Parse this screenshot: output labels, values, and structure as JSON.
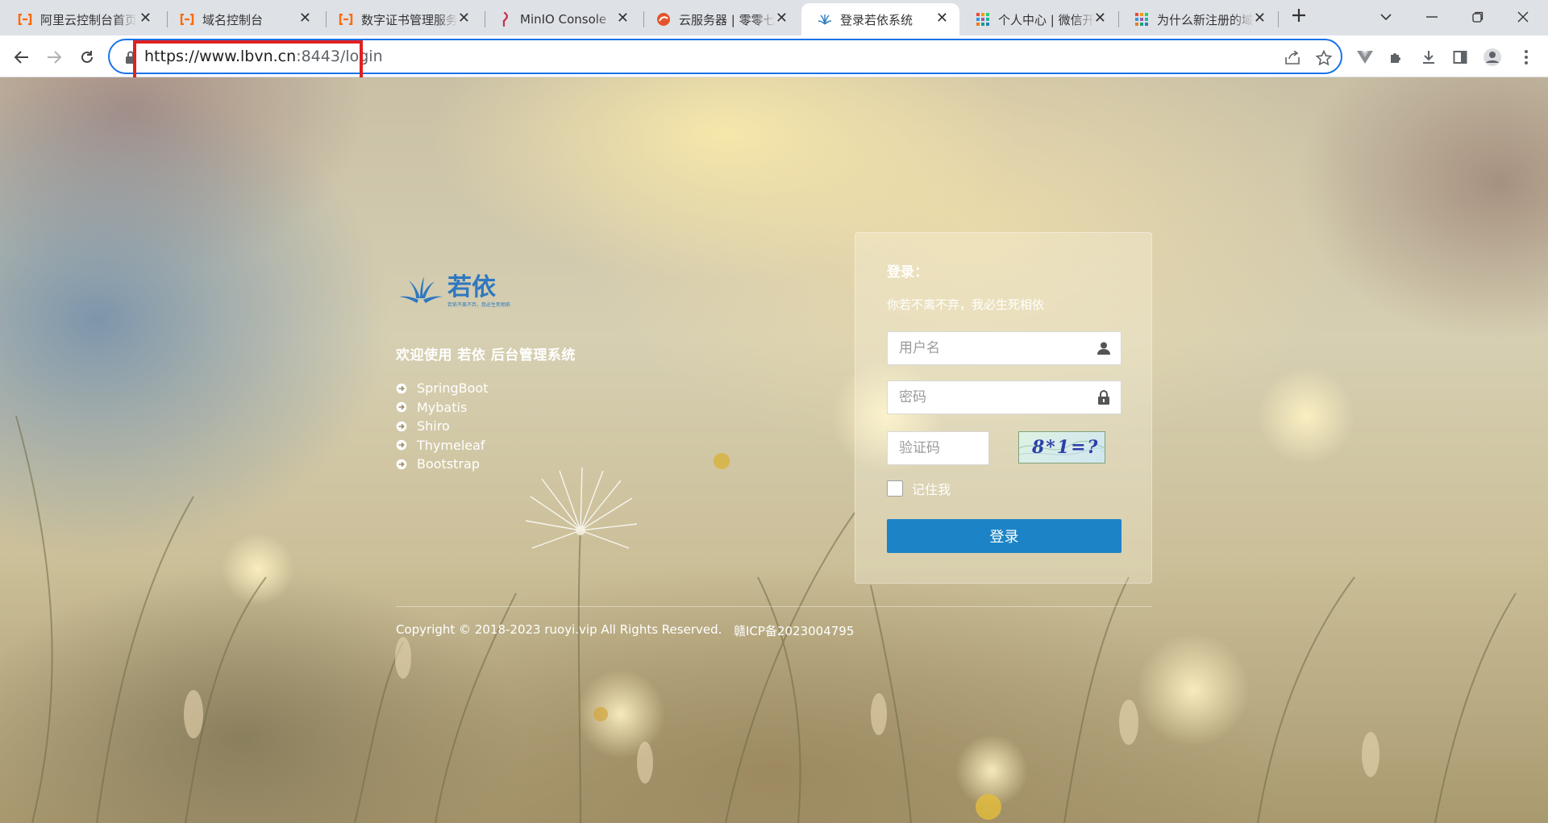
{
  "browser": {
    "tabs": [
      {
        "title": "阿里云控制台首页",
        "icon": "aliyun-icon",
        "active": false
      },
      {
        "title": "域名控制台",
        "icon": "aliyun-icon",
        "active": false
      },
      {
        "title": "数字证书管理服务",
        "icon": "aliyun-icon",
        "active": false
      },
      {
        "title": "MinIO Console",
        "icon": "minio-icon",
        "active": false
      },
      {
        "title": "云服务器 | 零零七",
        "icon": "cloud-server-icon",
        "active": false
      },
      {
        "title": "登录若依系统",
        "icon": "ruoyi-icon",
        "active": true
      },
      {
        "title": "个人中心 | 微信开",
        "icon": "grid-app-icon",
        "active": false
      },
      {
        "title": "为什么新注册的域",
        "icon": "grid-app-icon",
        "active": false
      }
    ],
    "close_glyph": "✕",
    "url": {
      "host": "https://www.lbvn.cn",
      "rest": ":8443/login"
    },
    "colors": {
      "tab_strip": "#dee1e6",
      "omnibox_border": "#1a73e8",
      "url_highlight": "#e02020"
    }
  },
  "login_page": {
    "brand": {
      "logo_text": "若依",
      "logo_tagline": "若依不离不弃，我必生死相依"
    },
    "welcome": {
      "prefix": "欢迎使用 ",
      "brand": "若依",
      "suffix": " 后台管理系统"
    },
    "tech_stack": [
      "SpringBoot",
      "Mybatis",
      "Shiro",
      "Thymeleaf",
      "Bootstrap"
    ],
    "form": {
      "title": "登录：",
      "motto": "你若不离不弃，我必生死相依",
      "username_placeholder": "用户名",
      "password_placeholder": "密码",
      "captcha_placeholder": "验证码",
      "captcha_text": "8*1=?",
      "remember_label": "记住我",
      "submit_label": "登录"
    },
    "footer": {
      "copyright": "Copyright © 2018-2023 ruoyi.vip All Rights Reserved.",
      "icp": "赣ICP备2023004795"
    },
    "colors": {
      "submit_button": "#1c84c6",
      "text_on_background": "#ffffff"
    }
  }
}
